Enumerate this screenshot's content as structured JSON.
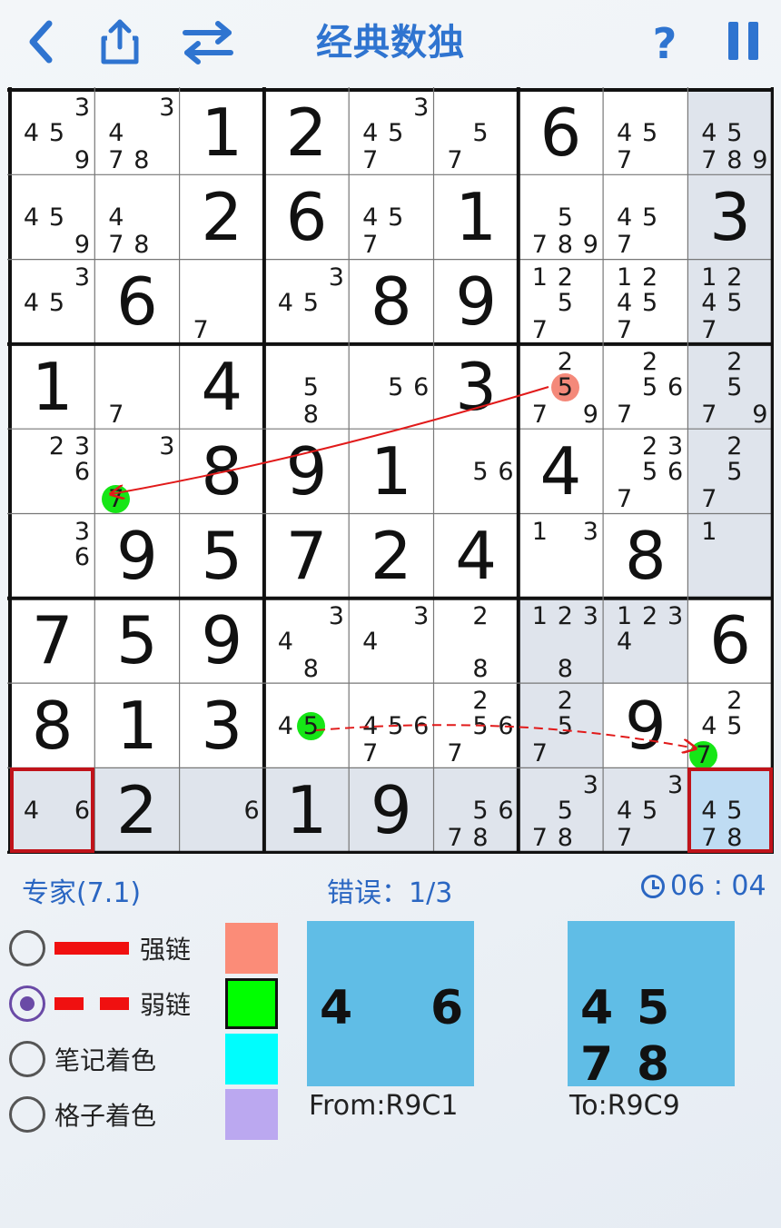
{
  "header": {
    "title": "经典数独",
    "icons": [
      "back-icon",
      "share-icon",
      "swap-icon",
      "help-icon",
      "pause-icon"
    ],
    "accent_color": "#2f74d0"
  },
  "board": {
    "rows": [
      [
        {
          "c": "345 9"
        },
        {
          "c": "3478"
        },
        {
          "v": "1"
        },
        {
          "v": "2"
        },
        {
          "c": "3457"
        },
        {
          "c": "57"
        },
        {
          "v": "6"
        },
        {
          "c": "457"
        },
        {
          "c": "45789"
        }
      ],
      [
        {
          "c": "459"
        },
        {
          "c": "478"
        },
        {
          "v": "2"
        },
        {
          "v": "6"
        },
        {
          "c": "457"
        },
        {
          "v": "1"
        },
        {
          "c": "5789"
        },
        {
          "c": "457"
        },
        {
          "v": "3"
        }
      ],
      [
        {
          "c": "345"
        },
        {
          "v": "6"
        },
        {
          "c": "7"
        },
        {
          "c": "345"
        },
        {
          "v": "8"
        },
        {
          "v": "9"
        },
        {
          "c": "1257"
        },
        {
          "c": "12457"
        },
        {
          "c": "12457"
        }
      ],
      [
        {
          "v": "1"
        },
        {
          "c": "7"
        },
        {
          "v": "4"
        },
        {
          "c": "58"
        },
        {
          "c": "56"
        },
        {
          "v": "3"
        },
        {
          "c": "2579"
        },
        {
          "c": "2567"
        },
        {
          "c": "2579"
        }
      ],
      [
        {
          "c": "236"
        },
        {
          "c": "37"
        },
        {
          "v": "8"
        },
        {
          "v": "9"
        },
        {
          "v": "1"
        },
        {
          "c": "56"
        },
        {
          "v": "4"
        },
        {
          "c": "23567"
        },
        {
          "c": "257"
        }
      ],
      [
        {
          "c": "36"
        },
        {
          "v": "9"
        },
        {
          "v": "5"
        },
        {
          "v": "7"
        },
        {
          "v": "2"
        },
        {
          "v": "4"
        },
        {
          "c": "13"
        },
        {
          "v": "8"
        },
        {
          "c": "1"
        }
      ],
      [
        {
          "v": "7"
        },
        {
          "v": "5"
        },
        {
          "v": "9"
        },
        {
          "c": "348"
        },
        {
          "c": "34"
        },
        {
          "c": "28"
        },
        {
          "c": "1238"
        },
        {
          "c": "1234"
        },
        {
          "v": "6"
        }
      ],
      [
        {
          "v": "8"
        },
        {
          "v": "1"
        },
        {
          "v": "3"
        },
        {
          "c": "45"
        },
        {
          "c": "4567"
        },
        {
          "c": "2567"
        },
        {
          "c": "257"
        },
        {
          "v": "9"
        },
        {
          "c": "245"
        }
      ],
      [
        {
          "c": "46"
        },
        {
          "v": "2"
        },
        {
          "c": "6"
        },
        {
          "v": "1"
        },
        {
          "v": "9"
        },
        {
          "c": "5678"
        },
        {
          "c": "3578"
        },
        {
          "c": "3457"
        },
        {
          "c": "4578"
        }
      ]
    ],
    "colors": {
      "strong_link": "#e11a1a",
      "red_marker": "#f4897a",
      "green_marker": "#16e616",
      "outline": "#c0131a",
      "selected_bg": "#bfdcf3",
      "highlight_bg": "#dfe4ec"
    }
  },
  "status": {
    "difficulty": "专家(7.1)",
    "errors": "错误：1/3",
    "timer": "06 : 04"
  },
  "link_options": [
    {
      "label": "强链",
      "selected": false
    },
    {
      "label": "弱链",
      "selected": true
    },
    {
      "label": "笔记着色",
      "selected": false
    },
    {
      "label": "格子着色",
      "selected": false
    }
  ],
  "swatches": [
    "#fb8c78",
    "#00ff00",
    "#00fdfd",
    "#bba8f0"
  ],
  "from_preview": {
    "caption": "From:R9C1",
    "digits": [
      "4",
      "",
      "6",
      "",
      "",
      ""
    ]
  },
  "to_preview": {
    "caption": "To:R9C9",
    "digits": [
      "4",
      "5",
      "7",
      "8"
    ]
  }
}
